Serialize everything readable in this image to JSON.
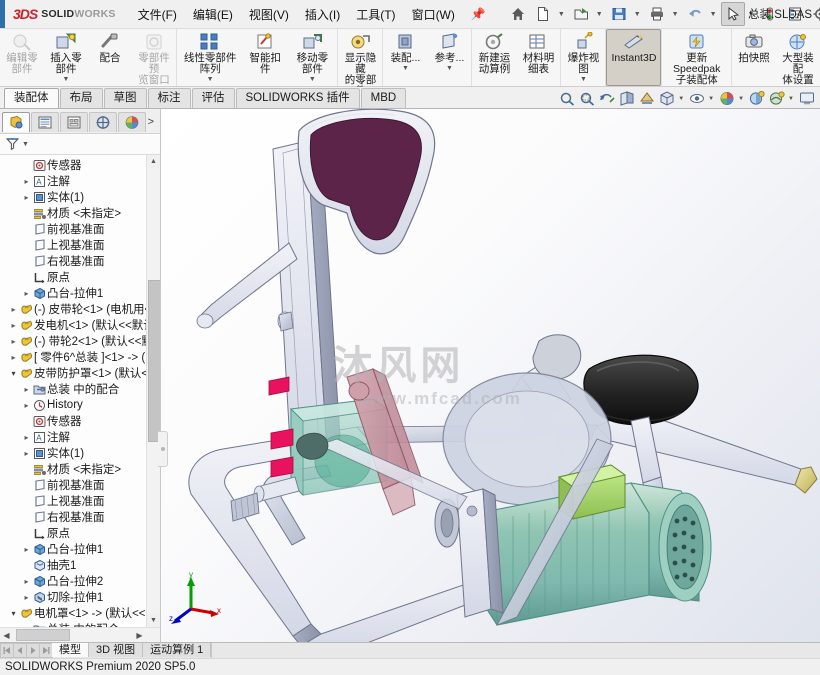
{
  "app": {
    "brand_mark": "3DS",
    "brand_bold": "SOLID",
    "brand_light": "WORKS",
    "document_title": "总装.SLDAS"
  },
  "menubar": {
    "items": [
      {
        "label": "文件(F)",
        "name": "menu-file"
      },
      {
        "label": "编辑(E)",
        "name": "menu-edit"
      },
      {
        "label": "视图(V)",
        "name": "menu-view"
      },
      {
        "label": "插入(I)",
        "name": "menu-insert"
      },
      {
        "label": "工具(T)",
        "name": "menu-tools"
      },
      {
        "label": "窗口(W)",
        "name": "menu-window"
      }
    ],
    "pin_icon": "pin-icon"
  },
  "quick_access": {
    "buttons": [
      {
        "name": "home-icon",
        "caret": false
      },
      {
        "name": "new-document-icon",
        "caret": true
      },
      {
        "name": "open-document-icon",
        "caret": true
      },
      {
        "name": "save-icon",
        "caret": true
      },
      {
        "name": "print-icon",
        "caret": true
      },
      {
        "name": "undo-icon",
        "caret": true
      },
      {
        "name": "select-cursor-icon",
        "caret": true
      },
      {
        "name": "rebuild-icon",
        "caret": false
      },
      {
        "name": "options-list-icon",
        "caret": false
      },
      {
        "name": "settings-gear-icon",
        "caret": true
      }
    ]
  },
  "ribbon": {
    "groups": [
      {
        "name": "assembly-edit-group",
        "buttons": [
          {
            "label": "编辑零\n部件",
            "name": "edit-component-button",
            "icon": "edit-component-icon",
            "state": "disabled",
            "dropdown": false
          },
          {
            "label": "插入零部件",
            "name": "insert-components-button",
            "icon": "insert-component-icon",
            "state": "normal",
            "dropdown": true
          },
          {
            "label": "配合",
            "name": "mate-button",
            "icon": "mate-icon",
            "state": "normal",
            "dropdown": false
          },
          {
            "label": "零部件预\n览窗口",
            "name": "component-preview-button",
            "icon": "component-preview-icon",
            "state": "disabled",
            "dropdown": false
          }
        ]
      },
      {
        "name": "pattern-group",
        "buttons": [
          {
            "label": "线性零部件阵列",
            "name": "linear-component-pattern-button",
            "icon": "linear-pattern-icon",
            "state": "normal",
            "dropdown": true
          },
          {
            "label": "智能扣\n件",
            "name": "smart-fasteners-button",
            "icon": "smart-fastener-icon",
            "state": "normal",
            "dropdown": false
          },
          {
            "label": "移动零部件",
            "name": "move-component-button",
            "icon": "move-component-icon",
            "state": "normal",
            "dropdown": true
          }
        ]
      },
      {
        "name": "visibility-group",
        "buttons": [
          {
            "label": "显示隐藏\n的零部件",
            "name": "show-hidden-components-button",
            "icon": "show-hidden-icon",
            "state": "normal",
            "dropdown": false
          }
        ]
      },
      {
        "name": "features-group",
        "buttons": [
          {
            "label": "装配...",
            "name": "assembly-features-button",
            "icon": "assembly-feature-icon",
            "state": "normal",
            "dropdown": true
          },
          {
            "label": "参考...",
            "name": "reference-geometry-button",
            "icon": "reference-geometry-icon",
            "state": "normal",
            "dropdown": true
          }
        ]
      },
      {
        "name": "motion-bom-group",
        "buttons": [
          {
            "label": "新建运\n动算例",
            "name": "new-motion-study-button",
            "icon": "new-motion-study-icon",
            "state": "normal",
            "dropdown": false
          },
          {
            "label": "材料明\n细表",
            "name": "bill-of-materials-button",
            "icon": "bom-icon",
            "state": "normal",
            "dropdown": false
          }
        ]
      },
      {
        "name": "explode-group",
        "buttons": [
          {
            "label": "爆炸视图",
            "name": "exploded-view-button",
            "icon": "exploded-view-icon",
            "state": "normal",
            "dropdown": true
          }
        ]
      },
      {
        "name": "instant3d-group",
        "buttons": [
          {
            "label": "Instant3D",
            "name": "instant3d-button",
            "icon": "instant3d-icon",
            "state": "active",
            "dropdown": false
          }
        ]
      },
      {
        "name": "speedpak-group",
        "buttons": [
          {
            "label": "更新 Speedpak\n子装配体",
            "name": "update-speedpak-button",
            "icon": "speedpak-icon",
            "state": "normal",
            "dropdown": false
          }
        ]
      },
      {
        "name": "snapshot-group",
        "buttons": [
          {
            "label": "拍快照",
            "name": "take-snapshot-button",
            "icon": "camera-icon",
            "state": "normal",
            "dropdown": false
          },
          {
            "label": "大型装配\n体设置",
            "name": "large-assembly-settings-button",
            "icon": "large-assembly-icon",
            "state": "normal",
            "dropdown": false
          }
        ]
      }
    ]
  },
  "command_tabs": {
    "items": [
      {
        "label": "装配体",
        "name": "tab-assembly",
        "selected": true
      },
      {
        "label": "布局",
        "name": "tab-layout",
        "selected": false
      },
      {
        "label": "草图",
        "name": "tab-sketch",
        "selected": false
      },
      {
        "label": "标注",
        "name": "tab-markup",
        "selected": false
      },
      {
        "label": "评估",
        "name": "tab-evaluate",
        "selected": false
      },
      {
        "label": "SOLIDWORKS 插件",
        "name": "tab-solidworks-addins",
        "selected": false
      },
      {
        "label": "MBD",
        "name": "tab-mbd",
        "selected": false
      }
    ]
  },
  "view_toolbar": {
    "buttons": [
      {
        "name": "zoom-to-fit-icon",
        "caret": false
      },
      {
        "name": "zoom-to-area-icon",
        "caret": false
      },
      {
        "name": "previous-view-icon",
        "caret": false
      },
      {
        "name": "section-view-icon",
        "caret": false
      },
      {
        "name": "view-orientation-icon",
        "caret": false
      },
      {
        "name": "display-style-icon",
        "caret": true
      },
      {
        "name": "hide-show-items-icon",
        "caret": true
      },
      {
        "name": "edit-appearance-icon",
        "caret": true
      },
      {
        "name": "apply-scene-icon",
        "caret": false
      },
      {
        "name": "view-settings-icon",
        "caret": true
      },
      {
        "name": "viewport-layout-icon",
        "caret": false
      }
    ]
  },
  "tree_panel": {
    "tabs": [
      {
        "name": "feature-manager-tab",
        "icon": "feature-manager-icon",
        "selected": true
      },
      {
        "name": "property-manager-tab",
        "icon": "property-manager-icon",
        "selected": false
      },
      {
        "name": "configuration-manager-tab",
        "icon": "configuration-manager-icon",
        "selected": false
      },
      {
        "name": "dimxpert-manager-tab",
        "icon": "dimxpert-icon",
        "selected": false
      },
      {
        "name": "display-manager-tab",
        "icon": "display-manager-icon",
        "selected": false
      }
    ],
    "expand_label": ">",
    "filter_icon": "filter-icon",
    "nodes": [
      {
        "label": "传感器",
        "indent": 1,
        "twisty": "none",
        "icon": "sensor-icon"
      },
      {
        "label": "注解",
        "indent": 1,
        "twisty": "collapsed",
        "icon": "annotations-icon"
      },
      {
        "label": "实体(1)",
        "indent": 1,
        "twisty": "collapsed",
        "icon": "solid-bodies-icon"
      },
      {
        "label": "材质 <未指定>",
        "indent": 1,
        "twisty": "none",
        "icon": "material-icon"
      },
      {
        "label": "前视基准面",
        "indent": 1,
        "twisty": "none",
        "icon": "plane-icon"
      },
      {
        "label": "上视基准面",
        "indent": 1,
        "twisty": "none",
        "icon": "plane-icon"
      },
      {
        "label": "右视基准面",
        "indent": 1,
        "twisty": "none",
        "icon": "plane-icon"
      },
      {
        "label": "原点",
        "indent": 1,
        "twisty": "none",
        "icon": "origin-icon"
      },
      {
        "label": "凸台-拉伸1",
        "indent": 1,
        "twisty": "collapsed",
        "icon": "extrude-icon"
      },
      {
        "label": "(-) 皮带轮<1> (电机用<",
        "indent": 0,
        "twisty": "collapsed",
        "icon": "component-icon"
      },
      {
        "label": "发电机<1> (默认<<默认",
        "indent": 0,
        "twisty": "collapsed",
        "icon": "component-icon"
      },
      {
        "label": "(-) 带轮2<1> (默认<<默",
        "indent": 0,
        "twisty": "collapsed",
        "icon": "component-icon"
      },
      {
        "label": "[ 零件6^总装 ]<1> -> (",
        "indent": 0,
        "twisty": "collapsed",
        "icon": "component-icon"
      },
      {
        "label": "皮带防护罩<1> (默认<",
        "indent": 0,
        "twisty": "expanded",
        "icon": "component-icon"
      },
      {
        "label": "总装 中的配合",
        "indent": 1,
        "twisty": "collapsed",
        "icon": "mates-folder-icon"
      },
      {
        "label": "History",
        "indent": 1,
        "twisty": "collapsed",
        "icon": "history-icon"
      },
      {
        "label": "传感器",
        "indent": 1,
        "twisty": "none",
        "icon": "sensor-icon"
      },
      {
        "label": "注解",
        "indent": 1,
        "twisty": "collapsed",
        "icon": "annotations-icon"
      },
      {
        "label": "实体(1)",
        "indent": 1,
        "twisty": "collapsed",
        "icon": "solid-bodies-icon"
      },
      {
        "label": "材质 <未指定>",
        "indent": 1,
        "twisty": "none",
        "icon": "material-icon"
      },
      {
        "label": "前视基准面",
        "indent": 1,
        "twisty": "none",
        "icon": "plane-icon"
      },
      {
        "label": "上视基准面",
        "indent": 1,
        "twisty": "none",
        "icon": "plane-icon"
      },
      {
        "label": "右视基准面",
        "indent": 1,
        "twisty": "none",
        "icon": "plane-icon"
      },
      {
        "label": "原点",
        "indent": 1,
        "twisty": "none",
        "icon": "origin-icon"
      },
      {
        "label": "凸台-拉伸1",
        "indent": 1,
        "twisty": "collapsed",
        "icon": "extrude-icon"
      },
      {
        "label": "抽壳1",
        "indent": 1,
        "twisty": "none",
        "icon": "shell-icon"
      },
      {
        "label": "凸台-拉伸2",
        "indent": 1,
        "twisty": "collapsed",
        "icon": "extrude-icon"
      },
      {
        "label": "切除-拉伸1",
        "indent": 1,
        "twisty": "collapsed",
        "icon": "cut-extrude-icon"
      },
      {
        "label": "电机罩<1> -> (默认<<",
        "indent": 0,
        "twisty": "expanded",
        "icon": "component-icon"
      },
      {
        "label": "总装 中的配合",
        "indent": 1,
        "twisty": "collapsed",
        "icon": "mates-folder-icon"
      }
    ]
  },
  "viewport": {
    "watermark_main": "沐风网",
    "watermark_sub": "www.mfcad.com",
    "triad": {
      "x_label": "x",
      "y_label": "y",
      "z_label": "z",
      "x_color": "#cc0000",
      "y_color": "#00a000",
      "z_color": "#0000cc"
    }
  },
  "bottom_tabs": {
    "nav": [
      "first-icon",
      "previous-icon",
      "next-icon",
      "last-icon"
    ],
    "items": [
      {
        "label": "模型",
        "name": "bottom-tab-model",
        "selected": true
      },
      {
        "label": "3D 视图",
        "name": "bottom-tab-3dviews",
        "selected": false
      },
      {
        "label": "运动算例 1",
        "name": "bottom-tab-motion-study-1",
        "selected": false
      }
    ]
  },
  "status_bar": {
    "text": "SOLIDWORKS Premium 2020 SP5.0"
  },
  "colors": {
    "accent": "#2f6fa8",
    "brand_red": "#cf2027",
    "ribbon_bg": "#f6f6f6",
    "selection": "#d4d0c8"
  }
}
